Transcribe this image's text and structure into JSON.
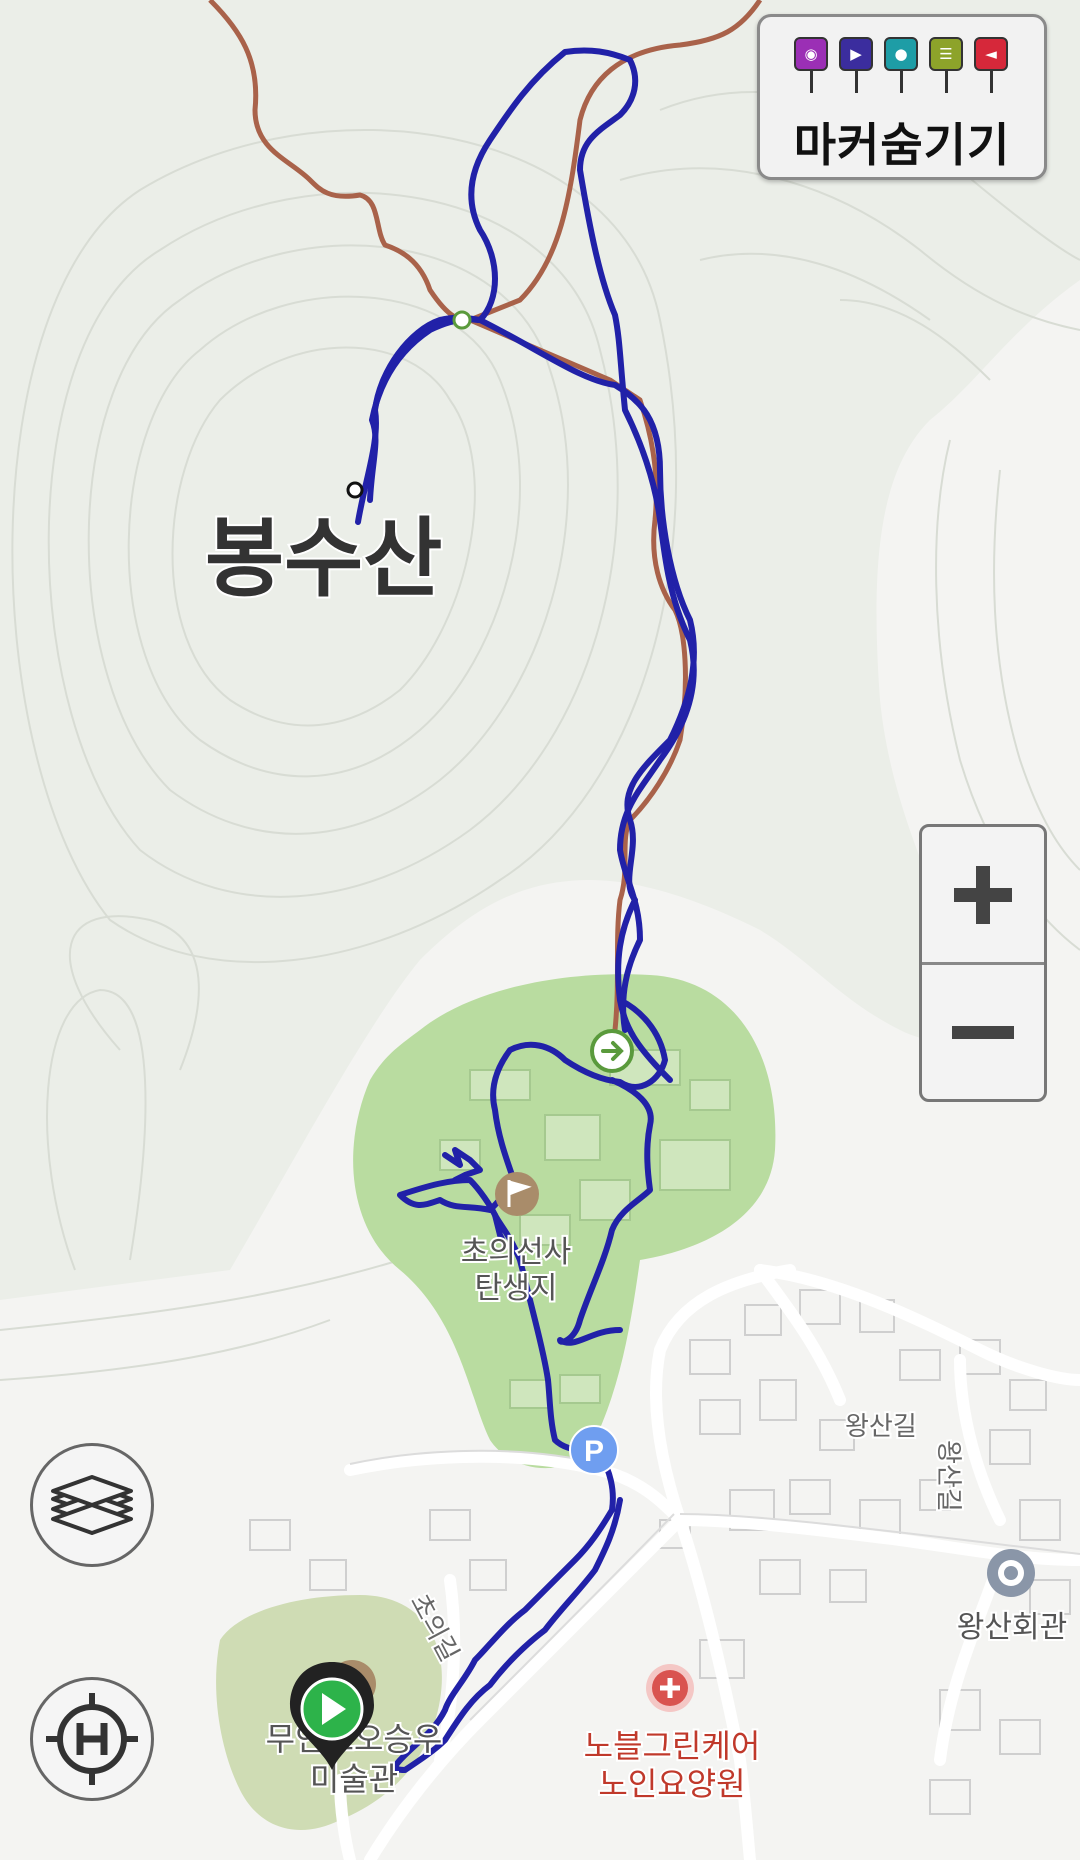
{
  "map": {
    "peak_label": "봉수산",
    "labels": {
      "birthplace_line1": "초의선사",
      "birthplace_line2": "탄생지",
      "wangsan_gil_1": "왕산길",
      "wangsan_gil_2": "왕산길",
      "choui_gil": "초의길",
      "community_hall": "왕산회관",
      "nursing_home_line1": "노블그린케어",
      "nursing_home_line2": "노인요양원",
      "museum_line1": "무인도오승우",
      "museum_line2": "미술관"
    },
    "colors": {
      "track": "#2121a8",
      "trail": "#a9624a",
      "park": "#b9dca0",
      "mountain": "#ebeee8",
      "hospital": "#d9534f",
      "parking": "#6f9ef0",
      "poi_brown": "#a98c6a"
    }
  },
  "marker_panel": {
    "label": "마커숨기기",
    "pins": [
      {
        "icon": "camera-icon",
        "color": "#9b2fb5"
      },
      {
        "icon": "video-icon",
        "color": "#3b2d9e"
      },
      {
        "icon": "microphone-icon",
        "color": "#1e9da6"
      },
      {
        "icon": "note-icon",
        "color": "#8da32a"
      },
      {
        "icon": "flag-icon",
        "color": "#d6283a"
      }
    ]
  },
  "controls": {
    "zoom_in": "+",
    "zoom_out": "−",
    "layers": "layers-icon",
    "home": "helipad-target-icon"
  },
  "points": {
    "parking": "P"
  }
}
